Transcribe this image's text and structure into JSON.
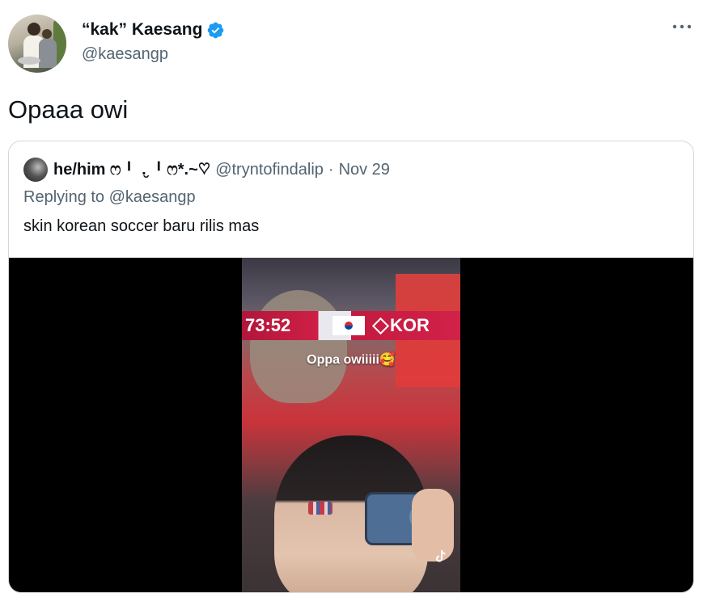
{
  "author": {
    "display_name": "“kak” Kaesang",
    "handle": "@kaesangp",
    "verified": true
  },
  "tweet": {
    "text": "Opaaa owi"
  },
  "quoted_tweet": {
    "display_name": "he/him ෆ╹ .̮ ╹ෆ*.~♡",
    "handle": "@tryntofindalip",
    "separator": "·",
    "date": "Nov 29",
    "replying_to": "Replying to @kaesangp",
    "text": "skin korean soccer baru rilis mas",
    "video": {
      "score_time": "73:52",
      "team": "KOR",
      "caption": "Oppa owiiiii🥰"
    }
  },
  "icons": {
    "verified": "verified-badge-icon",
    "more": "more-options-icon",
    "tiktok": "tiktok-icon"
  },
  "colors": {
    "accent": "#1d9bf0",
    "secondary_text": "#536471",
    "border": "#cfd9de"
  }
}
